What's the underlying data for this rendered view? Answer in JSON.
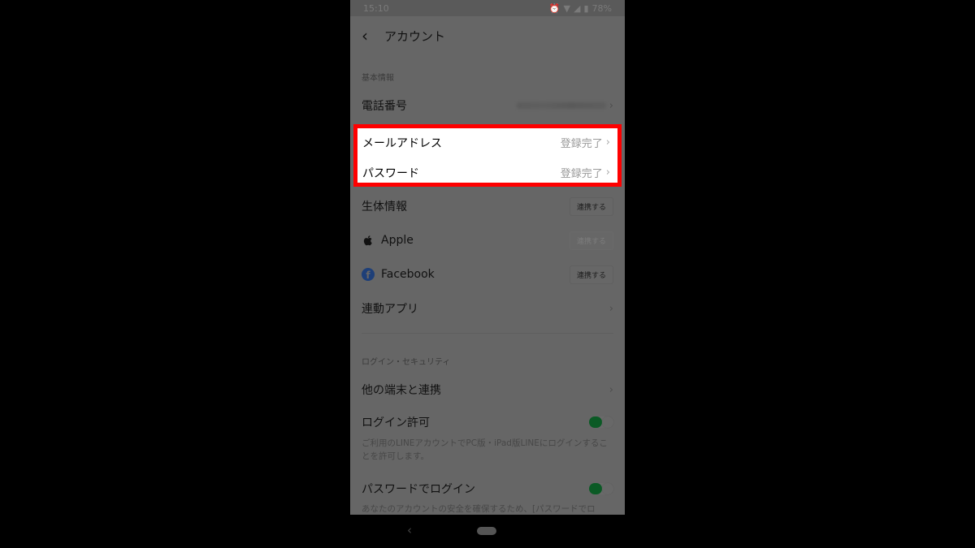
{
  "status_bar": {
    "time": "15:10",
    "battery": "78%",
    "icons": [
      "alarm-icon",
      "wifi-icon",
      "signal-icon",
      "battery-icon"
    ]
  },
  "header": {
    "back_icon": "chevron-left",
    "title": "アカウント"
  },
  "sections": {
    "basic_info": {
      "label": "基本情報",
      "phone": {
        "label": "電話番号",
        "value": "(blurred)"
      },
      "email": {
        "label": "メールアドレス",
        "value": "登録完了"
      },
      "password": {
        "label": "パスワード",
        "value": "登録完了"
      },
      "biometrics": {
        "label": "生体情報",
        "button": "連携する"
      },
      "apple": {
        "label": "Apple",
        "button": "連携する",
        "disabled": true
      },
      "facebook": {
        "label": "Facebook",
        "button": "連携する"
      },
      "linked_apps": {
        "label": "連動アプリ"
      }
    },
    "login_security": {
      "label": "ログイン・セキュリティ",
      "other_devices": {
        "label": "他の端末と連携"
      },
      "login_permission": {
        "label": "ログイン許可",
        "enabled": true,
        "description": "ご利用のLINEアカウントでPC版・iPad版LINEにログインすることを許可します。"
      },
      "password_login": {
        "label": "パスワードでログイン",
        "enabled": true,
        "description": "あなたのアカウントの安全を確保するため、[パスワードでロ"
      }
    }
  },
  "colors": {
    "highlight_border": "#ff0000",
    "toggle_on": "#0b5a25",
    "facebook": "#1e3f78"
  }
}
